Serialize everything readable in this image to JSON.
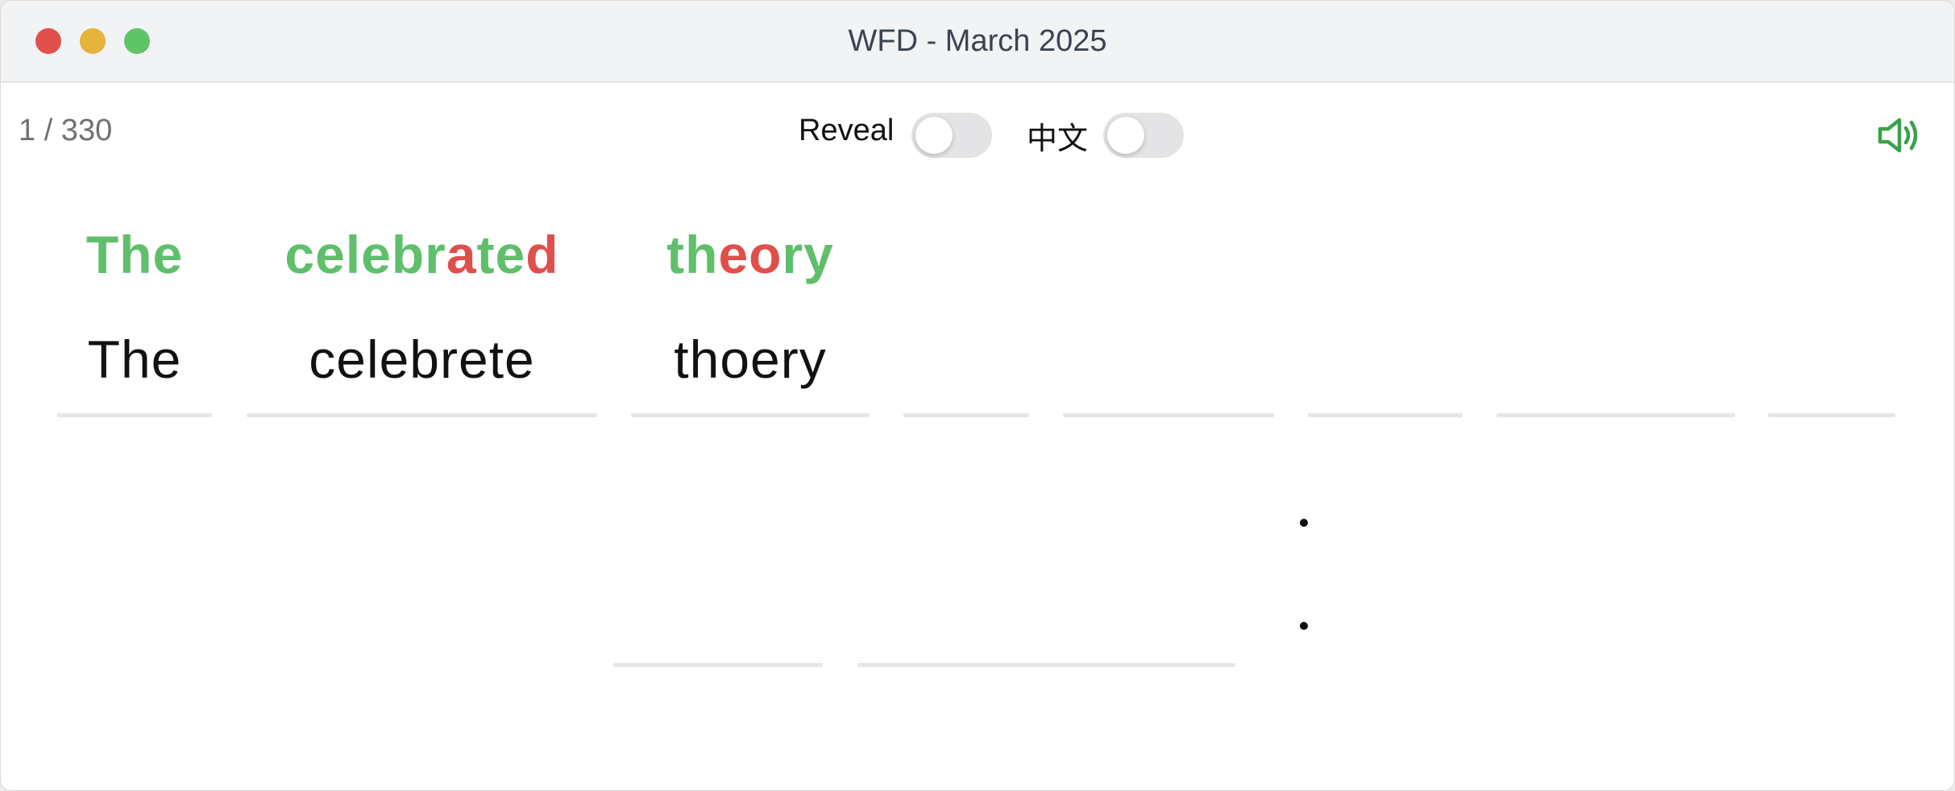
{
  "window": {
    "title": "WFD - March 2025"
  },
  "toolbar": {
    "counter": "1 / 330",
    "reveal_label": "Reveal",
    "reveal_on": false,
    "chinese_label": "中文",
    "chinese_on": false,
    "speaker_icon": "speaker-icon",
    "accent_color": "#3aa14a"
  },
  "colors": {
    "correct": "#5fbf6b",
    "error": "#df4f4c"
  },
  "sentence1": {
    "words": [
      {
        "typed": "The",
        "correct_segments": [
          {
            "t": "The",
            "ok": true
          }
        ]
      },
      {
        "typed": "celebrete",
        "correct_segments": [
          {
            "t": "celebr",
            "ok": true
          },
          {
            "t": "a",
            "ok": false
          },
          {
            "t": "te",
            "ok": true
          },
          {
            "t": "d",
            "ok": false
          }
        ]
      },
      {
        "typed": "thoery",
        "correct_segments": [
          {
            "t": "th",
            "ok": true
          },
          {
            "t": "eo",
            "ok": false
          },
          {
            "t": "ry",
            "ok": true
          }
        ]
      },
      {
        "typed": "",
        "correct_segments": []
      },
      {
        "typed": "",
        "correct_segments": []
      },
      {
        "typed": "",
        "correct_segments": []
      },
      {
        "typed": "",
        "correct_segments": []
      },
      {
        "typed": "",
        "correct_segments": []
      }
    ]
  },
  "sentence2": {
    "words": [
      {
        "typed": ""
      },
      {
        "typed": ""
      }
    ]
  }
}
